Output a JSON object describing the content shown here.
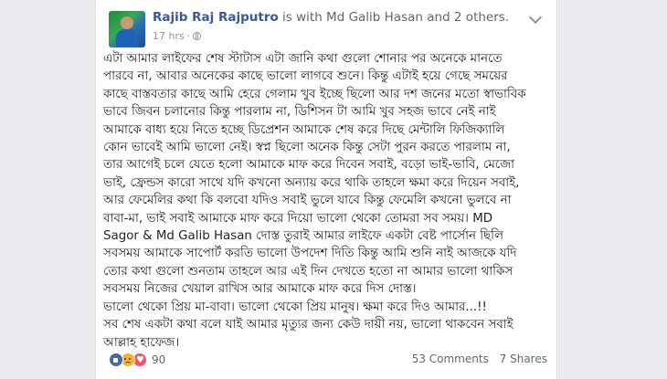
{
  "post": {
    "author": "Rajib Raj Rajputro",
    "with_text": "is with Md Galib Hasan and 2 others.",
    "timestamp": "17 hrs",
    "separator": "·",
    "body_lines": [
      "এটা আমার লাইফের শেষ স্টাটাস এটা জানি কথা গুলো শোনার পর অনেকে মানতে",
      "পারবে না, আবার অনেকের কাছে ভালো লাগবে শুনে। কিন্তু এটাই হয়ে গেছে সময়ের",
      "কাছে বাস্তবতার কাছে আমি হেরে গেলাম খুব ইচ্ছে ছিলো আর দশ জনের মতো স্বাভাবিক",
      "ভাবে জিবন চলানোর কিন্তু পারলাম না, ডিশিসন টা আমি খুব সহজ ভাবে নেই নাই",
      "আমাকে বাধ্য হয়ে নিতে হচ্ছে ডিপ্রেশন আমাকে শেষ করে দিছে মেন্টালি ফিজিক্যালি",
      "কোন ভাবেই আমি ভালো নেই। স্বপ্ন ছিলো অনেক কিন্তু সেটা পুরন করতে পারলাম না,",
      "তার আগেই চলে যেতে হলো আমাকে মাফ করে দিবেন সবাই, বড়ো ভাই-ভাবি, মেজো",
      "ভাই, ফ্রেন্ডস কারো সাথে যদি কখনো অন্যায় করে থাকি তাহলে ক্ষমা করে দিয়েন সবাই,",
      "আর ফেমেলির কথা কি বলবো যদিও সবাই ভুলে যাবে কিন্তু ফেমেলি কখনো ভুলবে না",
      "বাবা-মা, ভাই সবাই আমাকে মাফ করে দিয়ো ভালো থেকো তোমরা সব সময়। MD",
      "Sagor & Md Galib Hasan দোস্ত তুরাই আমার লাইফে একটা বেষ্ট পার্সোন ছিলি",
      "সবসময় আমাকে সাপোর্ট করতি ভালো উপদেশ দিতি কিন্তু আমি শুনি নাই আজকে যদি",
      "তোর কথা গুলো শুনতাম তাহলে আর এই দিন দেখতে হতো না আমার ভালো থাকিস",
      "সবসময় নিজের খেয়াল রাখিস আর আমাকে মাফ করে দিস দোস্ত।",
      "ভালো থেকো প্রিয় মা-বাবা। ভালো থেকো প্রিয় মানুষ। ক্ষমা করে দিও আমার...!!",
      "সব শেষ একটা কথা বলে যাই আমার মৃত্যুর জন্য কেউ দায়ী নয়, ভালো থাকবেন সবাই",
      "আল্লাহ হাফেজ।"
    ]
  },
  "footer": {
    "reaction_count": "90",
    "comments": "53 Comments",
    "shares": "7 Shares",
    "reaction_icons": [
      "like-icon",
      "sad-icon",
      "love-icon"
    ]
  },
  "colors": {
    "page_bg": "#e9ebee",
    "link": "#385898",
    "text": "#1d2129",
    "meta": "#90949c"
  }
}
